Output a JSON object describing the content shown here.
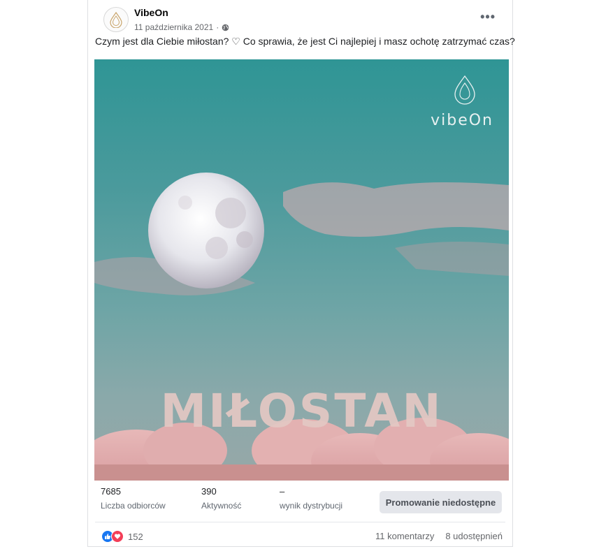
{
  "post": {
    "page_name": "VibeOn",
    "date": "11 października 2021",
    "separator": "·",
    "more_label": "•••",
    "text": "Czym jest dla Ciebie miłostan? ♡ Co sprawia, że jest Ci najlepiej i masz ochotę zatrzymać czas?"
  },
  "photo": {
    "logo_text": "vibeOn",
    "title": "MIŁOSTAN"
  },
  "stats": [
    {
      "value": "7685",
      "label": "Liczba odbiorców"
    },
    {
      "value": "390",
      "label": "Aktywność"
    },
    {
      "value": "–",
      "label": "wynik dystrybucji"
    }
  ],
  "promo_button": "Promowanie niedostępne",
  "footer": {
    "reaction_count": "152",
    "comments": "11 komentarzy",
    "shares": "8 udostępnień"
  },
  "colors": {
    "like": "#1877f2",
    "love": "#f33e58",
    "sky": "#2f9595"
  },
  "icons": [
    "vibeon-logo-icon",
    "globe-icon",
    "more-icon",
    "like-icon",
    "love-icon",
    "vibeon-drop-icon"
  ]
}
